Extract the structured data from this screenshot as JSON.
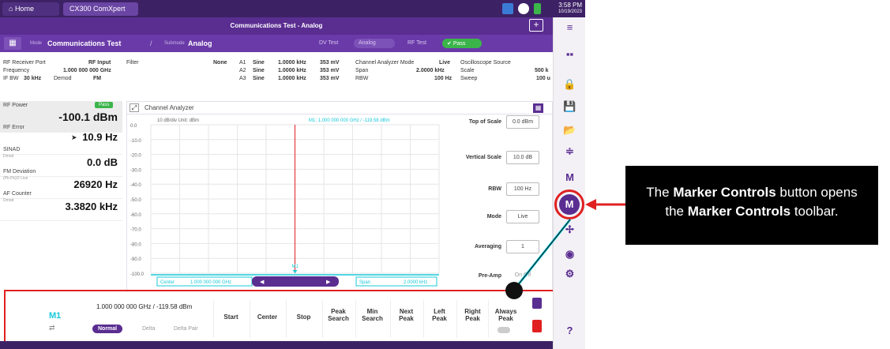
{
  "topbar": {
    "home_tab": "Home",
    "app_tab": "CX300 ComXpert",
    "time": "3:58 PM",
    "date": "10/19/2023"
  },
  "titlebar": {
    "title": "Communications Test - Analog",
    "plus": "+"
  },
  "crumbs": {
    "grid_glyph": "▦",
    "mode_small": "Mode",
    "mode": "Communications Test",
    "sep": "/",
    "sub_small": "Submode",
    "sub": "Analog",
    "pills": [
      "DV Test",
      "Analog",
      "RF Test",
      "Pass"
    ]
  },
  "info": {
    "rf_port_lbl": "RF Receiver Port",
    "rf_port": "RF Input",
    "freq_lbl": "Frequency",
    "freq": "1.000 000 000 GHz",
    "ifbw_lbl": "IF BW",
    "ifbw": "30 kHz",
    "demod_lbl": "Demod",
    "demod": "FM",
    "filter_lbl": "Filter",
    "filter": "None",
    "gens": [
      {
        "id": "A1",
        "shape": "Sine",
        "freq": "1.0000 kHz",
        "lvl": "353 mV"
      },
      {
        "id": "A2",
        "shape": "Sine",
        "freq": "1.0000 kHz",
        "lvl": "353 mV"
      },
      {
        "id": "A3",
        "shape": "Sine",
        "freq": "1.0000 kHz",
        "lvl": "353 mV"
      }
    ],
    "ca_mode_lbl": "Channel Analyzer Mode",
    "ca_mode": "Live",
    "span_lbl": "Span",
    "span": "2.0000 kHz",
    "rbw_lbl": "RBW",
    "rbw": "100 Hz",
    "osc_lbl": "Oscilloscope Source",
    "scale_lbl": "Scale",
    "scale": "500 k",
    "sweep_lbl": "Sweep",
    "sweep": "100 u"
  },
  "left": [
    {
      "label": "RF Power",
      "sub": "",
      "value": "-100.1 dBm",
      "badge": "Pass"
    },
    {
      "label": "RF Error",
      "sub": "",
      "value": "10.9 Hz",
      "badge": ""
    },
    {
      "label": "SINAD",
      "sub": "Dmod",
      "value": "0.0 dB",
      "badge": ""
    },
    {
      "label": "FM Deviation",
      "sub": "(Pk-Pk)/2 Live",
      "value": "26920 Hz",
      "badge": ""
    },
    {
      "label": "AF Counter",
      "sub": "Dmod",
      "value": "3.3820 kHz",
      "badge": ""
    }
  ],
  "chart_header": {
    "title": "Channel Analyzer",
    "expand": "⤢",
    "menu": "▦"
  },
  "chart_data": {
    "type": "line",
    "ylabel": "10 dB/div Unit: dBm",
    "y_ticks": [
      "0.0",
      "-10.0",
      "-20.0",
      "-30.0",
      "-40.0",
      "-50.0",
      "-60.0",
      "-70.0",
      "-80.0",
      "-90.0",
      "-100.0"
    ],
    "ylim": [
      -100,
      0
    ],
    "marker_readout": "M1: 1.000 000 000 GHz / -119.58 dBm",
    "marker_label": "M1",
    "center_lbl": "Center",
    "center": "1.000 000 000 GHz",
    "span_lbl": "Span",
    "span": "2.0000 kHz",
    "grid": true
  },
  "settings": [
    {
      "label": "Top of Scale",
      "value": "0.0 dBm"
    },
    {
      "label": "Vertical Scale",
      "value": "10.0 dB"
    },
    {
      "label": "RBW",
      "value": "100 Hz"
    },
    {
      "label": "Mode",
      "value": "Live"
    },
    {
      "label": "Averaging",
      "value": "1"
    },
    {
      "label": "Pre-Amp",
      "value": "On  Off"
    }
  ],
  "marker_toolbar": {
    "marker_id": "M1",
    "readout": "1.000 000 000 GHz / -119.58 dBm",
    "modes": [
      "Normal",
      "Delta",
      "Delta Pair"
    ],
    "buttons": [
      {
        "l1": "Start",
        "l2": ""
      },
      {
        "l1": "Center",
        "l2": ""
      },
      {
        "l1": "Stop",
        "l2": ""
      },
      {
        "l1": "Peak",
        "l2": "Search"
      },
      {
        "l1": "Min",
        "l2": "Search"
      },
      {
        "l1": "Next",
        "l2": "Peak"
      },
      {
        "l1": "Left",
        "l2": "Peak"
      },
      {
        "l1": "Right",
        "l2": "Peak"
      },
      {
        "l1": "Always",
        "l2": "Peak"
      }
    ]
  },
  "rightbar_icons": [
    "≡",
    "▪▪",
    "🔒",
    "💾",
    "📂",
    "≑",
    "M",
    "M",
    "✢",
    "◉",
    "⚙",
    "?"
  ],
  "annotation": {
    "line1_a": "The ",
    "line1_b": "Marker Controls",
    "line1_c": " button opens",
    "line2_a": "the ",
    "line2_b": "Marker Controls",
    "line2_c": " toolbar."
  },
  "colors": {
    "purple": "#5a2d91",
    "red": "#e02020",
    "pass": "#3bb54a",
    "cyan": "#19c8d8"
  }
}
